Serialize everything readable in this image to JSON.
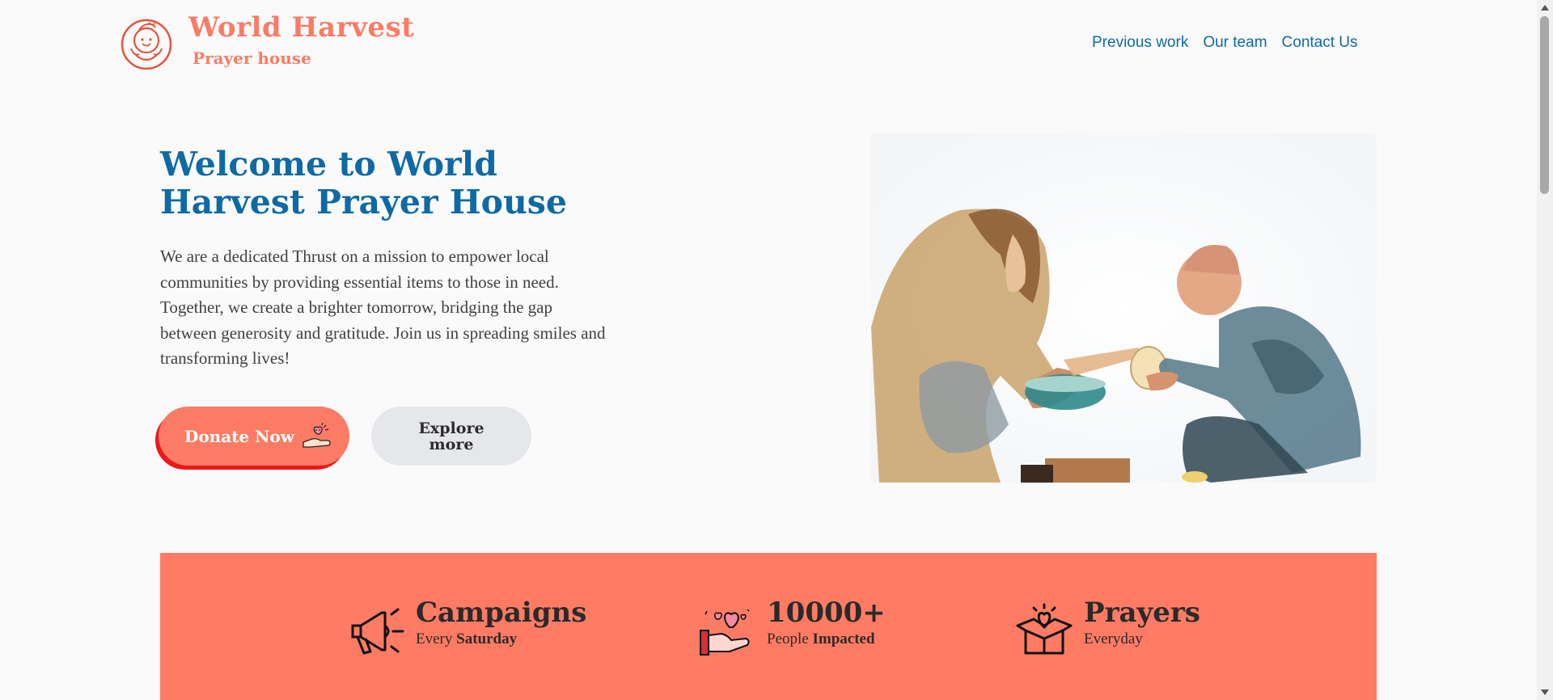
{
  "brand": {
    "title": "World Harvest",
    "subtitle": "Prayer house",
    "logo_icon": "smiling-child-logo",
    "accent_color": "#fb7b64"
  },
  "nav": {
    "items": [
      {
        "label": "Previous work"
      },
      {
        "label": "Our team"
      },
      {
        "label": "Contact Us"
      }
    ],
    "link_color": "#0e6aa4"
  },
  "hero": {
    "title": "Welcome to World Harvest Prayer House",
    "text": "We are a dedicated Thrust on a mission to empower local communities by providing essential items to those in need. Together, we create a brighter tomorrow, bridging the gap between generosity and gratitude. Join us in spreading smiles and transforming lives!",
    "donate_label": "Donate Now",
    "donate_icon": "heart-in-hand-icon",
    "explore_label": "Explore more",
    "image_icon": "watercolor-giving-illustration"
  },
  "stats": {
    "background": "#ff7b64",
    "items": [
      {
        "title": "Campaigns",
        "sub_prefix": "Every",
        "sub_bold": "Saturday",
        "icon": "megaphone-icon"
      },
      {
        "title": "10000+",
        "sub_prefix": "People",
        "sub_bold": "Impacted",
        "icon": "heart-hand-icon"
      },
      {
        "title": "Prayers",
        "sub_prefix": "Everyday",
        "sub_bold": "",
        "icon": "heart-box-icon"
      }
    ]
  }
}
